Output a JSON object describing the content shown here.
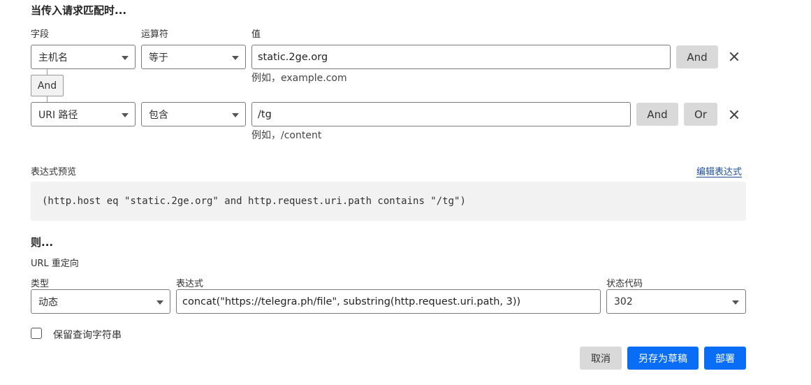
{
  "when": {
    "title": "当传入请求匹配时...",
    "col_field": "字段",
    "col_operator": "运算符",
    "col_value": "值",
    "rows": [
      {
        "field": "主机名",
        "operator": "等于",
        "value": "static.2ge.org",
        "hint": "例如，example.com"
      },
      {
        "field": "URI 路径",
        "operator": "包含",
        "value": "/tg",
        "hint": "例如，/content"
      }
    ],
    "and_chip": "And",
    "btn_and": "And",
    "btn_or": "Or",
    "preview_label": "表达式预览",
    "edit_expression": "编辑表达式",
    "preview_expression": "(http.host eq \"static.2ge.org\" and http.request.uri.path contains \"/tg\")"
  },
  "then": {
    "title": "则...",
    "action": "URL 重定向",
    "col_type": "类型",
    "col_expression": "表达式",
    "col_status": "状态代码",
    "type_value": "动态",
    "expression_value": "concat(\"https://telegra.ph/file\", substring(http.request.uri.path, 3))",
    "status_value": "302",
    "preserve_query": "保留查询字符串"
  },
  "footer": {
    "cancel": "取消",
    "save_draft": "另存为草稿",
    "deploy": "部署"
  },
  "colors": {
    "primary": "#0a6df6",
    "secondary_button": "#d9d9d9",
    "preview_bg": "#f2f2f2"
  }
}
